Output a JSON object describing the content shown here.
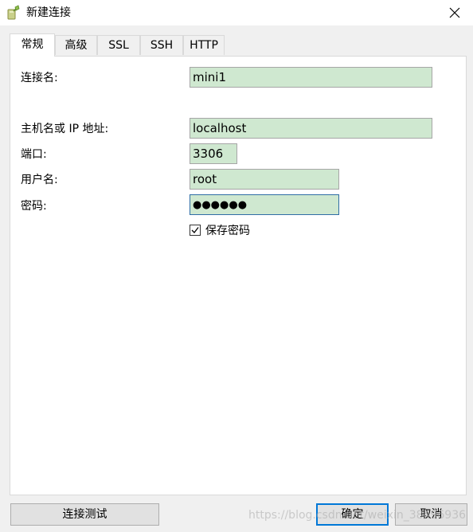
{
  "window": {
    "title": "新建连接",
    "icons": {
      "app": "connection-plug-icon",
      "close": "close-icon"
    }
  },
  "tabs": [
    {
      "label": "常规",
      "active": true
    },
    {
      "label": "高级",
      "active": false
    },
    {
      "label": "SSL",
      "active": false
    },
    {
      "label": "SSH",
      "active": false
    },
    {
      "label": "HTTP",
      "active": false
    }
  ],
  "form": {
    "connection_name": {
      "label": "连接名:",
      "value": "mini1"
    },
    "host": {
      "label": "主机名或 IP 地址:",
      "value": "localhost"
    },
    "port": {
      "label": "端口:",
      "value": "3306"
    },
    "username": {
      "label": "用户名:",
      "value": "root"
    },
    "password": {
      "label": "密码:",
      "value": "●●●●●●"
    },
    "save_password": {
      "label": "保存密码",
      "checked": true
    }
  },
  "buttons": {
    "test": "连接测试",
    "ok": "确定",
    "cancel": "取消"
  },
  "watermark": "https://blog.csdn.net/weixin_38496936",
  "colors": {
    "field_background": "#cfe8d0",
    "default_button_border": "#0078d7"
  }
}
